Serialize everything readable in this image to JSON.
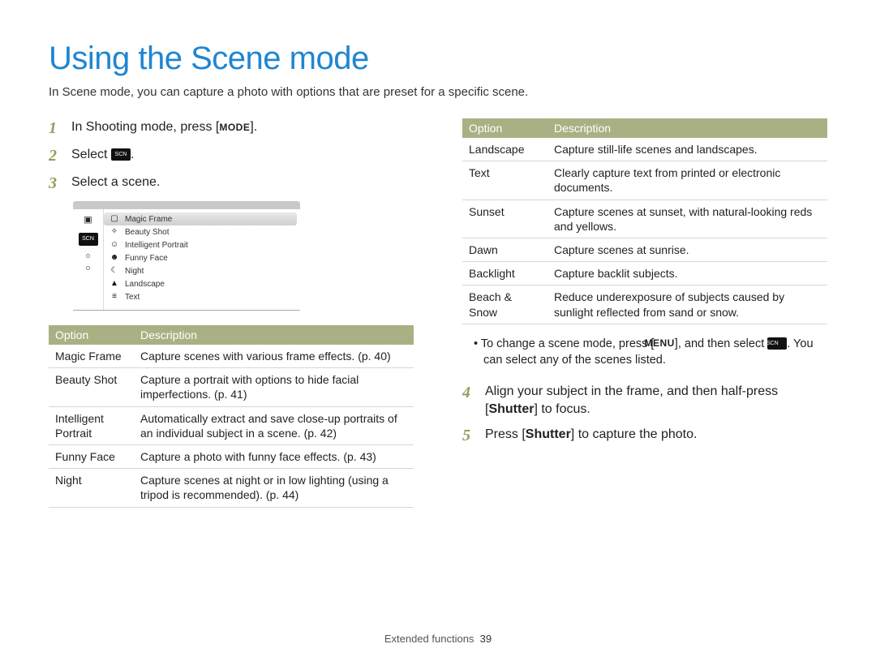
{
  "title": "Using the Scene mode",
  "intro": "In Scene mode, you can capture a photo with options that are preset for a specific scene.",
  "steps": {
    "s1": "In Shooting mode, press [",
    "s1_key": "MODE",
    "s1_after": "].",
    "s2_before": "Select ",
    "s2_after": ".",
    "s3": "Select a scene.",
    "s4_a": "Align your subject in the frame, and then half-press [",
    "s4_shutter": "Shutter",
    "s4_b": "] to focus.",
    "s5_a": "Press [",
    "s5_shutter": "Shutter",
    "s5_b": "] to capture the photo."
  },
  "sceneList": [
    "Magic Frame",
    "Beauty Shot",
    "Intelligent Portrait",
    "Funny Face",
    "Night",
    "Landscape",
    "Text"
  ],
  "tableHeaders": {
    "option": "Option",
    "desc": "Description"
  },
  "table1": [
    {
      "name": "Magic Frame",
      "desc": "Capture scenes with various frame effects. (p. 40)"
    },
    {
      "name": "Beauty Shot",
      "desc": "Capture a portrait with options to hide facial imperfections. (p. 41)"
    },
    {
      "name": "Intelligent Portrait",
      "desc": "Automatically extract and save close-up portraits of an individual subject in a scene. (p. 42)"
    },
    {
      "name": "Funny Face",
      "desc": "Capture a photo with funny face effects. (p. 43)"
    },
    {
      "name": "Night",
      "desc": "Capture scenes at night or in low lighting (using a tripod is recommended). (p. 44)"
    }
  ],
  "table2": [
    {
      "name": "Landscape",
      "desc": "Capture still-life scenes and landscapes."
    },
    {
      "name": "Text",
      "desc": "Clearly capture text from printed or electronic documents."
    },
    {
      "name": "Sunset",
      "desc": "Capture scenes at sunset, with natural-looking reds and yellows."
    },
    {
      "name": "Dawn",
      "desc": "Capture scenes at sunrise."
    },
    {
      "name": "Backlight",
      "desc": "Capture backlit subjects."
    },
    {
      "name": "Beach & Snow",
      "desc": "Reduce underexposure of subjects caused by sunlight reflected from sand or snow."
    }
  ],
  "note": {
    "a": "To change a scene mode, press [",
    "menu": "MENU",
    "b": "], and then select ",
    "c": ". You can select any of the scenes listed."
  },
  "footer": {
    "section": "Extended functions",
    "page": "39"
  }
}
